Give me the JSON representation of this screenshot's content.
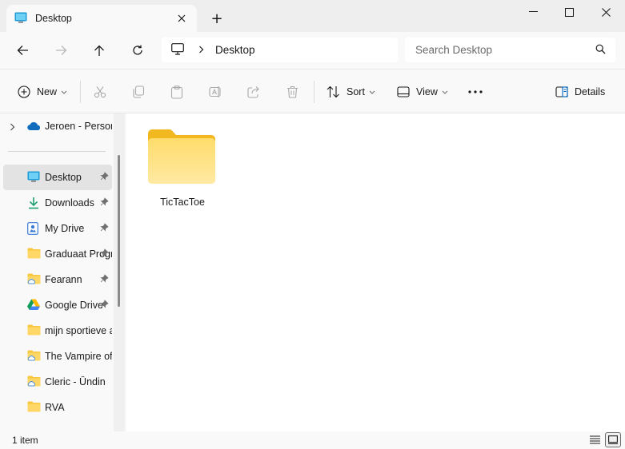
{
  "window": {
    "tab_title": "Desktop",
    "new_tab_glyph": "+",
    "controls": [
      "minimize",
      "maximize",
      "close"
    ]
  },
  "navigation": {
    "breadcrumb": [
      "Desktop"
    ],
    "search": {
      "placeholder": "Search Desktop",
      "value": ""
    }
  },
  "toolbar": {
    "new_label": "New",
    "sort_label": "Sort",
    "view_label": "View",
    "details_label": "Details"
  },
  "sidebar": {
    "top_item": {
      "label": "Jeroen - Personal",
      "icon": "onedrive-cloud-icon"
    },
    "items": [
      {
        "label": "Desktop",
        "icon": "desktop-icon",
        "pinned": true,
        "selected": true
      },
      {
        "label": "Downloads",
        "icon": "download-icon",
        "pinned": true
      },
      {
        "label": "My Drive",
        "icon": "drive-icon",
        "pinned": true
      },
      {
        "label": "Graduaat Programmeren",
        "icon": "folder-icon",
        "pinned": true
      },
      {
        "label": "Fearann",
        "icon": "folder-cloud-icon",
        "pinned": true
      },
      {
        "label": "Google Drive",
        "icon": "google-drive-icon",
        "pinned": true
      },
      {
        "label": "mijn sportieve avonturen",
        "icon": "folder-icon",
        "pinned": false
      },
      {
        "label": "The Vampire of Luxembourg",
        "icon": "folder-cloud-icon",
        "pinned": false
      },
      {
        "label": "Cleric - Ûndin",
        "icon": "folder-cloud-icon",
        "pinned": false
      },
      {
        "label": "RVA",
        "icon": "folder-icon",
        "pinned": false
      }
    ]
  },
  "content": {
    "items": [
      {
        "name": "TicTacToe",
        "type": "folder"
      }
    ]
  },
  "status": {
    "count": "1 item"
  },
  "colors": {
    "folder_yellow": "#f8c53c",
    "folder_light": "#ffe08a",
    "accent_blue": "#0067c0",
    "chrome": "#f9f9f9"
  }
}
